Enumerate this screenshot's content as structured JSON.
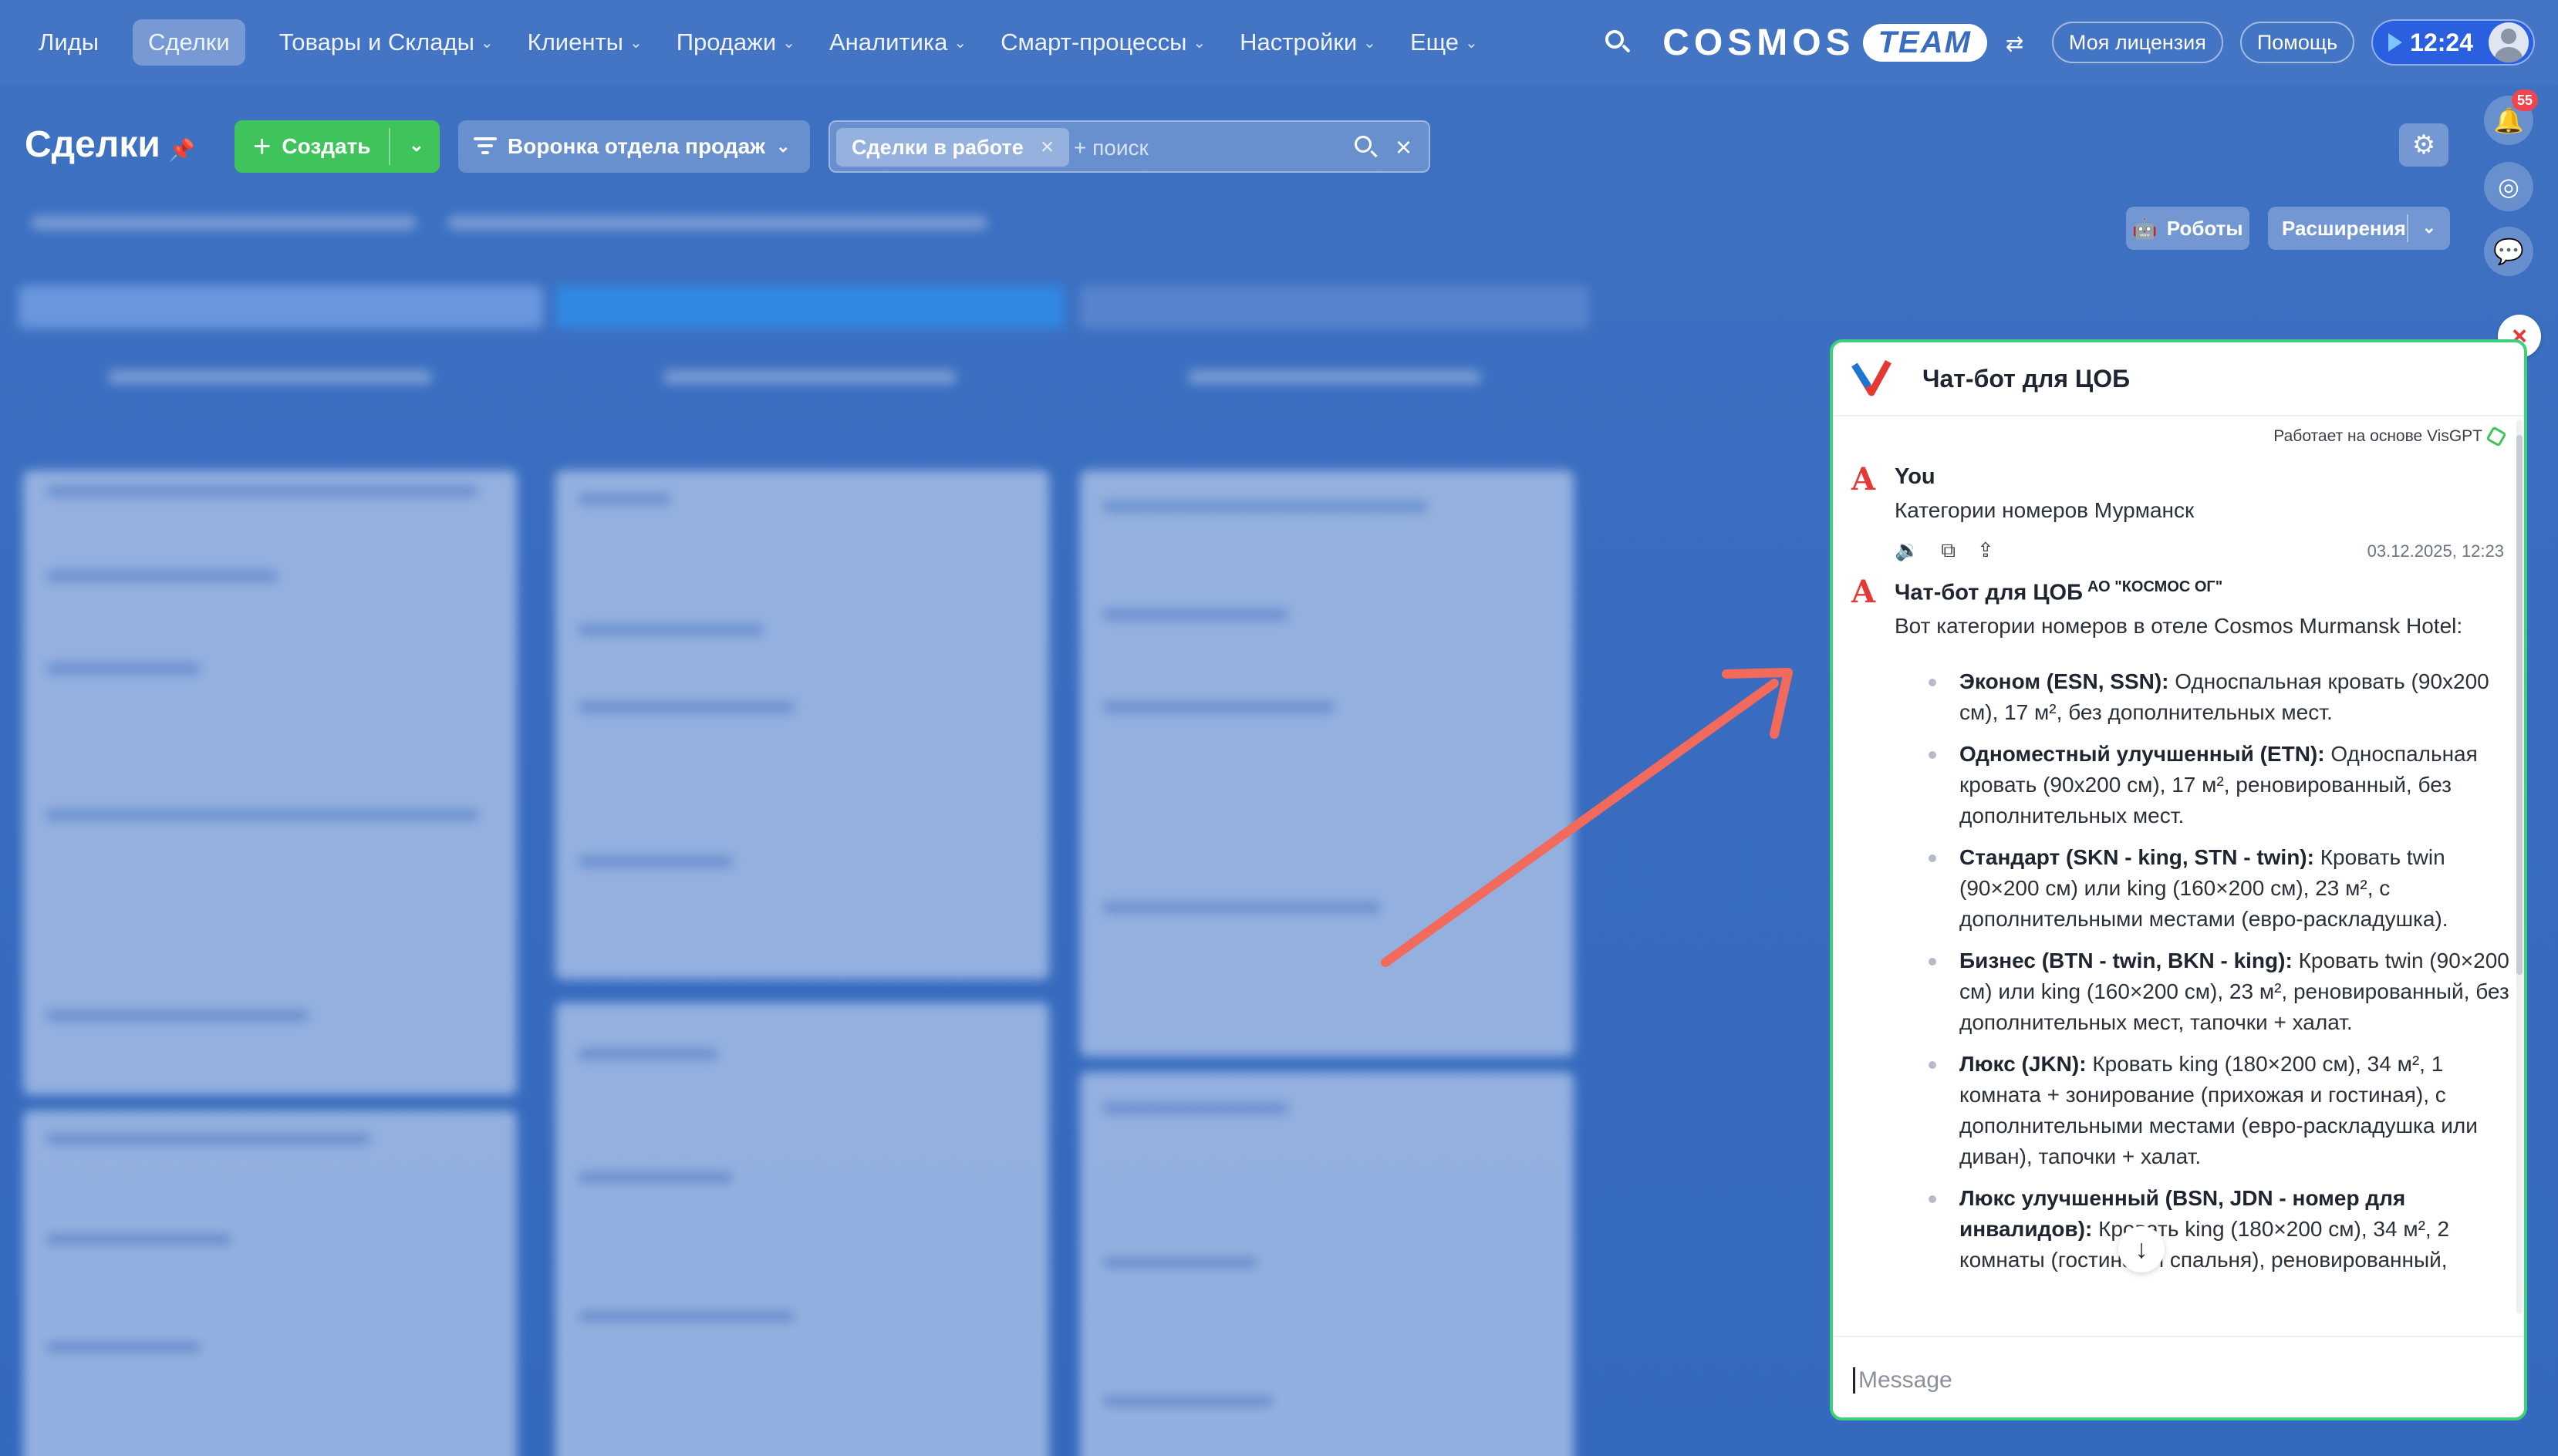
{
  "nav": {
    "items": [
      {
        "label": "Лиды",
        "has_menu": false,
        "active": false
      },
      {
        "label": "Сделки",
        "has_menu": false,
        "active": true
      },
      {
        "label": "Товары и Склады",
        "has_menu": true,
        "active": false
      },
      {
        "label": "Клиенты",
        "has_menu": true,
        "active": false
      },
      {
        "label": "Продажи",
        "has_menu": true,
        "active": false
      },
      {
        "label": "Аналитика",
        "has_menu": true,
        "active": false
      },
      {
        "label": "Смарт-процессы",
        "has_menu": true,
        "active": false
      },
      {
        "label": "Настройки",
        "has_menu": true,
        "active": false
      },
      {
        "label": "Еще",
        "has_menu": true,
        "active": false
      }
    ],
    "logo_text": "COSMOS",
    "logo_team": "TEAM",
    "license_label": "Моя лицензия",
    "help_label": "Помощь",
    "time": "12:24"
  },
  "header": {
    "title": "Сделки",
    "create_label": "Создать",
    "funnel_label": "Воронка отдела продаж",
    "filter_chip": "Сделки в работе",
    "filter_placeholder": "+ поиск",
    "robots_label": "Роботы",
    "extensions_label": "Расширения",
    "notifications_count": "55"
  },
  "chat": {
    "title": "Чат-бот для ЦОБ",
    "powered_by": "Работает на основе VisGPT",
    "user_name": "You",
    "user_message": "Категории номеров Мурманск",
    "timestamp": "03.12.2025, 12:23",
    "bot_name": "Чат-бот для ЦОБ",
    "bot_org": "АО \"КОСМОС ОГ\"",
    "bot_intro": "Вот категории номеров в отеле Cosmos Murmansk Hotel:",
    "items": [
      {
        "title": "Эконом (ESN, SSN):",
        "text": "Односпальная кровать (90x200 см), 17 м², без дополнительных мест."
      },
      {
        "title": "Одноместный улучшенный (ETN):",
        "text": "Односпальная кровать (90x200 см), 17 м², реновированный, без дополнительных мест."
      },
      {
        "title": "Стандарт (SKN - king, STN - twin):",
        "text": "Кровать twin (90×200 см) или king (160×200 см), 23 м², с дополнительными местами (евро-раскладушка)."
      },
      {
        "title": "Бизнес (BTN - twin, BKN - king):",
        "text": "Кровать twin (90×200 см) или king (160×200 см), 23 м², реновированный, без дополнительных мест, тапочки + халат."
      },
      {
        "title": "Люкс (JKN):",
        "text": "Кровать king (180×200 см), 34 м², 1 комната + зонирование (прихожая и гостиная), с дополнительными местами (евро-раскладушка или диван), тапочки + халат."
      },
      {
        "title": "Люкс улучшенный (BSN, JDN - номер для инвалидов):",
        "text": "Кровать king (180×200 см), 34 м², 2 комнаты (гостиная и спальня), реновированный,"
      }
    ],
    "input_placeholder": "Message"
  },
  "colors": {
    "nav_bg": "#4474c4",
    "page_bg": "#3a6dc0",
    "create_green": "#3ec45a",
    "chat_border": "#3ed07a",
    "arrow": "#f26a5b",
    "close_red": "#e53935"
  }
}
